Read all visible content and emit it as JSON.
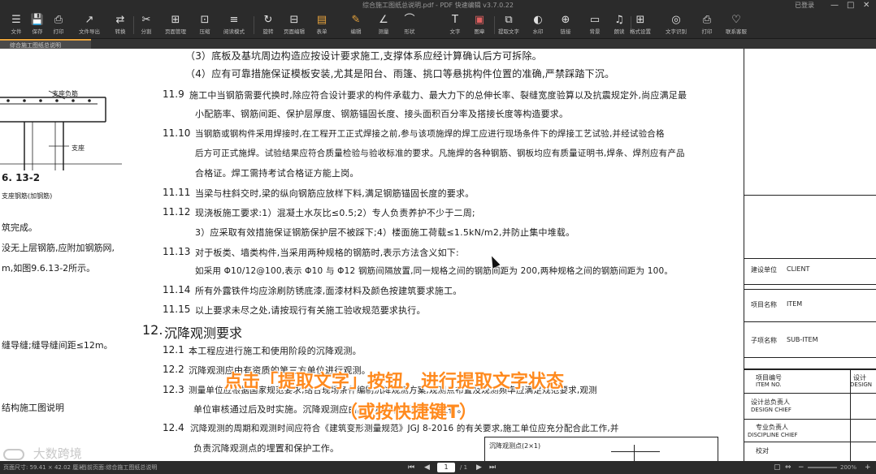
{
  "window": {
    "title": "综合施工图纸总说明.pdf - PDF 快速编辑 v3.7.0.22",
    "user": "已登录",
    "controls": [
      "—",
      "□",
      "✕"
    ]
  },
  "toolbar": {
    "buttons": [
      {
        "icon": "☰",
        "label": "文件"
      },
      {
        "icon": "💾",
        "label": "保存"
      },
      {
        "icon": "⎙",
        "label": "打印"
      },
      {
        "icon": "↗",
        "label": "文件导出"
      },
      {
        "icon": "⇄",
        "label": "转换"
      },
      {
        "icon": "✂",
        "label": "分割"
      },
      {
        "icon": "⊞",
        "label": "页面管理"
      },
      {
        "icon": "⊡",
        "label": "压缩"
      },
      {
        "icon": "≡",
        "label": "阅读模式"
      },
      {
        "icon": "↻",
        "label": "旋转"
      },
      {
        "icon": "⊟",
        "label": "页面编辑"
      },
      {
        "icon": "▤",
        "label": "表单"
      },
      {
        "icon": "✎",
        "label": "编辑"
      },
      {
        "icon": "∠",
        "label": "测量"
      },
      {
        "icon": "⌒",
        "label": "形状"
      },
      {
        "icon": "T",
        "label": "文字"
      },
      {
        "icon": "▣",
        "label": "图章"
      },
      {
        "icon": "⧉",
        "label": "提取文字"
      },
      {
        "icon": "◐",
        "label": "水印"
      },
      {
        "icon": "⊕",
        "label": "链接"
      },
      {
        "icon": "▭",
        "label": "背景"
      },
      {
        "icon": "♫",
        "label": "朗读"
      },
      {
        "icon": "⊞",
        "label": "格式设置"
      },
      {
        "icon": "◎",
        "label": "文字识别"
      },
      {
        "icon": "⎙",
        "label": "打印"
      },
      {
        "icon": "♡",
        "label": "联系客服"
      }
    ]
  },
  "tab": {
    "label": "综合施工图纸总说明"
  },
  "doc": {
    "left_lines": [
      {
        "text": "支座负筋"
      },
      {
        "text": "支座"
      },
      {
        "text": "6. 13-2"
      },
      {
        "text": "支座钢筋(加钢筋)"
      },
      {
        "text": "筑完成。"
      },
      {
        "text": "没无上层钢筋,应附加钢筋网,"
      },
      {
        "text": "m,如图9.6.13-2所示。"
      },
      {
        "text": "缝导缝;缝导缝间距≤12m。"
      },
      {
        "text": "结构施工图说明"
      }
    ],
    "lines": [
      {
        "num": "",
        "text": "（3）底板及基坑周边构造应按设计要求施工,支撑体系应经计算确认后方可拆除。"
      },
      {
        "num": "",
        "text": "（4）应有可靠措施保证模板安装,尤其是阳台、雨篷、挑口等悬挑构件位置的准确,严禁踩踏下沉。"
      },
      {
        "num": "11.9",
        "text": "施工中当钢筋需要代换时,除应符合设计要求的构件承载力、最大力下的总伸长率、裂缝宽度验算以及抗震规定外,尚应满足最"
      },
      {
        "num": "",
        "text": "小配筋率、钢筋间距、保护层厚度、钢筋锚固长度、接头面积百分率及搭接长度等构造要求。"
      },
      {
        "num": "11.10",
        "text": "当钢筋或钢构件采用焊接时,在工程开工正式焊接之前,参与该项施焊的焊工应进行现场条件下的焊接工艺试验,并经试验合格"
      },
      {
        "num": "",
        "text": "后方可正式施焊。试验结果应符合质量检验与验收标准的要求。凡施焊的各种钢筋、钢板均应有质量证明书,焊条、焊剂应有产品"
      },
      {
        "num": "",
        "text": "合格证。焊工需持考试合格证方能上岗。"
      },
      {
        "num": "11.11",
        "text": "当梁与柱斜交时,梁的纵向钢筋应放样下料,满足钢筋锚固长度的要求。"
      },
      {
        "num": "11.12",
        "text": "现浇板施工要求:1）混凝土水灰比≤0.5;2）专人负责养护不少于二周;"
      },
      {
        "num": "",
        "text": "3）应采取有效措施保证钢筋保护层不被踩下;4）楼面施工荷载≤1.5kN/m2,并防止集中堆载。"
      },
      {
        "num": "11.13",
        "text": "对于板类、墙类构件,当采用两种规格的钢筋时,表示方法含义如下:"
      },
      {
        "num": "",
        "text": "如采用 Φ10/12@100,表示 Φ10 与 Φ12 钢筋间隔放置,同一规格之间的钢筋间距为 200,两种规格之间的钢筋间距为 100。"
      },
      {
        "num": "11.14",
        "text": "所有外露铁件均应涂刷防锈底漆,面漆材料及颜色按建筑要求施工。"
      },
      {
        "num": "11.15",
        "text": "以上要求未尽之处,请按现行有关施工验收规范要求执行。"
      },
      {
        "num": "12.",
        "text": "沉降观测要求"
      },
      {
        "num": "12.1",
        "text": "本工程应进行施工和使用阶段的沉降观测。"
      },
      {
        "num": "12.2",
        "text": "沉降观测应由有资质的第三方单位进行观测。"
      },
      {
        "num": "12.3",
        "text": "测量单位应根据国家规范要求,结合现场条件编制沉降观测方案,观测点布置及观测频率应满足规范要求,观测"
      },
      {
        "num": "",
        "text": "单位审核通过后及时实施。沉降观测应由具有相应资质的单位进行。"
      },
      {
        "num": "12.4",
        "text": "沉降观测的周期和观测时间应符合《建筑变形测量规范》JGJ 8-2016 的有关要求,施工单位应充分配合此工作,并"
      },
      {
        "num": "",
        "text": "负责沉降观测点的埋置和保护工作。"
      }
    ],
    "detail_label": "沉降观测点(2×1)",
    "titleblock": [
      {
        "label": "建设单位",
        "value": "CLIENT"
      },
      {
        "label": "项目名称",
        "value": "ITEM"
      },
      {
        "label": "子项名称",
        "value": "SUB-ITEM"
      },
      {
        "label": "项目编号",
        "value": "ITEM NO."
      },
      {
        "label": "设计",
        "value": "DESIGN"
      },
      {
        "label": "设计总负责人",
        "value": "DESIGN CHIEF"
      },
      {
        "label": "专业负责人",
        "value": "DISCIPLINE CHIEF"
      },
      {
        "label": "校对",
        "value": ""
      }
    ]
  },
  "overlay": {
    "line1": "点击「提取文字」按钮，进行提取文字状态",
    "line2": "（或按快捷键T）"
  },
  "watermark": "大数跨境",
  "status": {
    "left": "页面尺寸: 59.41 × 42.02 厘米",
    "left2": "当前页面:综合施工图纸总说明",
    "page_current": "1",
    "page_total": "/ 1",
    "zoom": "200%"
  },
  "colors": {
    "accent": "#e6a23c",
    "overlay": "#ff8a1e",
    "toolbar": "#2b2b2b"
  }
}
